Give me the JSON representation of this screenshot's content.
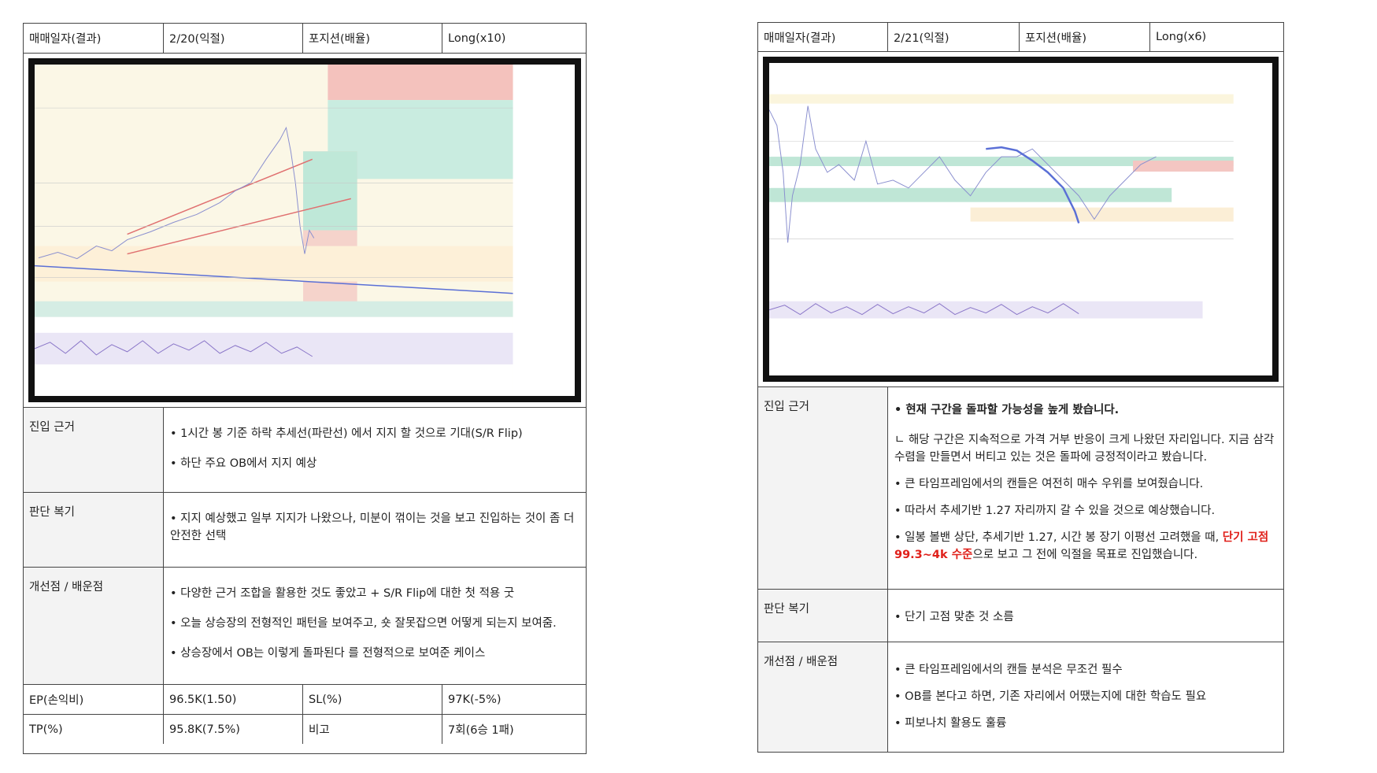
{
  "left": {
    "header": {
      "date_label": "매매일자(결과)",
      "date_value": "2/20(익절)",
      "position_label": "포지션(배율)",
      "position_value": "Long(x10)"
    },
    "entry_basis": {
      "label": "진입 근거",
      "items": [
        "• 1시간 봉 기준 하락 추세선(파란선) 에서 지지 할 것으로 기대(S/R Flip)",
        "• 하단 주요 OB에서 지지 예상"
      ]
    },
    "review": {
      "label": "판단 복기",
      "items": [
        "• 지지 예상했고 일부 지지가 나왔으나, 미분이 꺾이는 것을 보고 진입하는 것이 좀 더 안전한 선택"
      ]
    },
    "lessons": {
      "label": "개선점 / 배운점",
      "items": [
        "• 다양한 근거 조합을 활용한 것도 좋았고 + S/R Flip에 대한 첫 적용 굿",
        "• 오늘 상승장의 전형적인 패턴을 보여주고, 숏 잘못잡으면 어떻게 되는지 보여줌.",
        "• 상승장에서 OB는 이렇게 돌파된다 를 전형적으로 보여준 케이스"
      ]
    },
    "footer": {
      "ep_label": "EP(손익비)",
      "ep_value": "96.5K(1.50)",
      "sl_label": "SL(%)",
      "sl_value": "97K(-5%)",
      "tp_label": "TP(%)",
      "tp_value": "95.8K(7.5%)",
      "note_label": "비고",
      "note_value": "7회(6승 1패)"
    }
  },
  "right": {
    "header": {
      "date_label": "매매일자(결과)",
      "date_value": "2/21(익절)",
      "position_label": "포지션(배율)",
      "position_value": "Long(x6)"
    },
    "entry_basis": {
      "label": "진입 근거",
      "item1": "• 현재 구간을 돌파할 가능성을 높게 봤습니다.",
      "item2": "ㄴ 해당 구간은 지속적으로 가격 거부 반응이 크게 나왔던 자리입니다. 지금 삼각수렴을 만들면서 버티고 있는 것은 돌파에 긍정적이라고 봤습니다.",
      "item3": "• 큰 타임프레임에서의 캔들은 여전히 매수 우위를 보여줬습니다.",
      "item4": "• 따라서 추세기반 1.27 자리까지 갈 수 있을 것으로 예상했습니다.",
      "item5_pre": "• 일봉 볼밴 상단, 추세기반 1.27, 시간 봉 장기 이평선 고려했을 때, ",
      "item5_highlight": "단기 고점 99.3~4k 수준",
      "item5_post": "으로 보고 그 전에 익절을 목표로 진입했습니다."
    },
    "review": {
      "label": "판단 복기",
      "items": [
        "• 단기 고점 맞춘 것 소름"
      ]
    },
    "lessons": {
      "label": "개선점 / 배운점",
      "items": [
        "• 큰 타임프레임에서의 캔들 분석은 무조건 필수",
        "• OB를 본다고 하면, 기존 자리에서 어땠는지에 대한 학습도 필요",
        "• 피보나치 활용도 훌륭"
      ]
    }
  },
  "colors": {
    "border": "#444444",
    "label_bg": "#f3f3f3",
    "highlight_red": "#e0201a",
    "chart_frame": "#111111"
  }
}
